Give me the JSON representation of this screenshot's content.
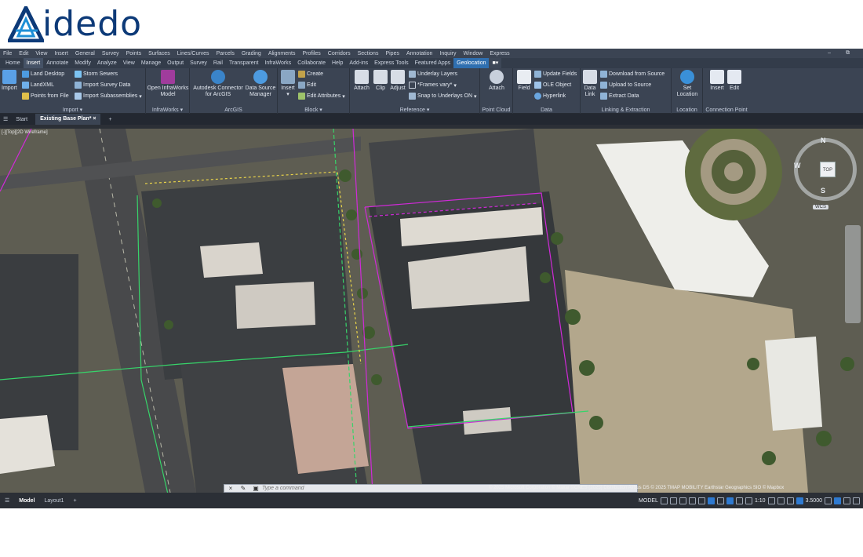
{
  "logo": {
    "text": "idedo"
  },
  "menubar": {
    "items": [
      "File",
      "Edit",
      "View",
      "Insert",
      "General",
      "Survey",
      "Points",
      "Surfaces",
      "Lines/Curves",
      "Parcels",
      "Grading",
      "Alignments",
      "Profiles",
      "Corridors",
      "Sections",
      "Pipes",
      "Annotation",
      "Inquiry",
      "Window",
      "Express"
    ]
  },
  "tabs": [
    "Home",
    "Insert",
    "Annotate",
    "Modify",
    "Analyze",
    "View",
    "Manage",
    "Output",
    "Survey",
    "Rail",
    "Transparent",
    "InfraWorks",
    "Collaborate",
    "Help",
    "Add-ins",
    "Express Tools",
    "Featured Apps",
    "Geolocation"
  ],
  "ribbon": {
    "import": {
      "title": "Import",
      "import_label": "Import",
      "land_desktop": "Land Desktop",
      "landxml": "LandXML",
      "points_from_file": "Points from File",
      "storm_sewers": "Storm Sewers",
      "import_survey_data": "Import Survey Data",
      "import_subassemblies": "Import Subassemblies"
    },
    "infraworks": {
      "title": "InfraWorks",
      "open_model_1": "Open InfraWorks",
      "open_model_2": "Model"
    },
    "arcgis": {
      "title": "ArcGIS",
      "connector_1": "Autodesk Connector",
      "connector_2": "for ArcGIS",
      "dsm_1": "Data Source",
      "dsm_2": "Manager"
    },
    "block": {
      "title": "Block",
      "insert": "Insert",
      "create": "Create",
      "edit": "Edit",
      "edit_attributes": "Edit Attributes"
    },
    "reference": {
      "title": "Reference",
      "attach": "Attach",
      "clip": "Clip",
      "adjust": "Adjust",
      "underlay_layers": "Underlay Layers",
      "frames_vary": "*Frames vary*",
      "snap_to_underlays": "Snap to Underlays ON"
    },
    "point_cloud": {
      "title": "Point Cloud",
      "attach": "Attach"
    },
    "data": {
      "title": "Data",
      "field": "Field",
      "update_fields": "Update Fields",
      "ole_object": "OLE Object",
      "hyperlink": "Hyperlink"
    },
    "linking": {
      "title": "Linking & Extraction",
      "data_link_1": "Data",
      "data_link_2": "Link",
      "download": "Download from Source",
      "upload": "Upload to Source",
      "extract": "Extract  Data"
    },
    "location": {
      "title": "Location",
      "set_1": "Set",
      "set_2": "Location"
    },
    "connection_point": {
      "title": "Connection Point",
      "insert": "Insert",
      "edit": "Edit"
    }
  },
  "doc_tabs": {
    "start": "Start",
    "active": "Existing Base Plan*"
  },
  "viewport": {
    "label": "[-][Top][2D Wireframe]",
    "navcube": {
      "north": "N",
      "south": "S",
      "west": "W",
      "top": "TOP",
      "wcs": "WCS"
    },
    "command_placeholder": "Type a command",
    "copyright": "© 2025 Microsoft Corporation © Maxar ©CNES (2025) Distribution Airbus DS © 2025 TMAP MOBILITY Earthstar Geographics SIO © Mapbox"
  },
  "layout_tabs": [
    "Model",
    "Layout1"
  ],
  "status": {
    "model": "MODEL",
    "scale": "1:10",
    "precision": "3.5000"
  },
  "colors": {
    "brand": "#0d3a78",
    "ribbon_bg": "#3b4453",
    "active_tab": "#2f6fb0",
    "magenta_lines": "#d02ad8",
    "green_lines": "#37d46a"
  }
}
